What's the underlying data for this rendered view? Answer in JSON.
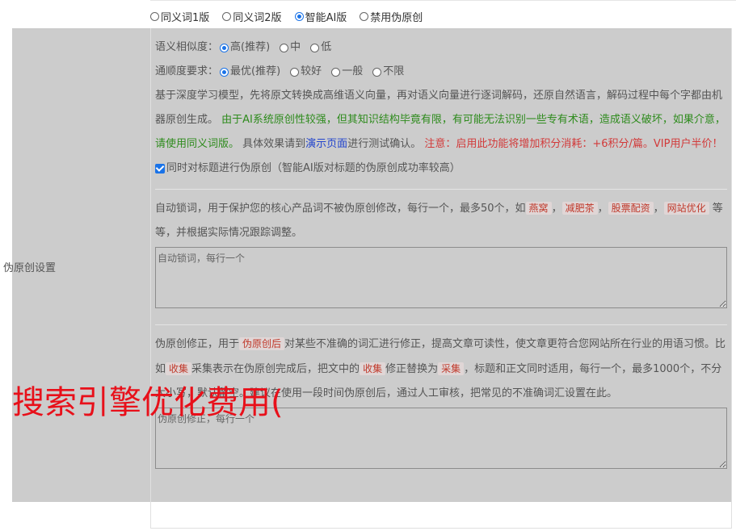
{
  "mode_options": [
    {
      "label": "同义词1版",
      "checked": false
    },
    {
      "label": "同义词2版",
      "checked": false
    },
    {
      "label": "智能AI版",
      "checked": true
    },
    {
      "label": "禁用伪原创",
      "checked": false
    }
  ],
  "side_label": "伪原创设置",
  "similarity": {
    "label": "语义相似度：",
    "options": [
      {
        "label": "高(推荐)",
        "checked": true
      },
      {
        "label": "中",
        "checked": false
      },
      {
        "label": "低",
        "checked": false
      }
    ]
  },
  "fluency": {
    "label": "通顺度要求：",
    "options": [
      {
        "label": "最优(推荐)",
        "checked": true
      },
      {
        "label": "较好",
        "checked": false
      },
      {
        "label": "一般",
        "checked": false
      },
      {
        "label": "不限",
        "checked": false
      }
    ]
  },
  "description": {
    "part1": "基于深度学习模型，先将原文转换成高维语义向量，再对语义向量进行逐词解码，还原自然语言，解码过程中每个字都由机器原创生成。",
    "part2_green": "由于AI系统原创性较强，但其知识结构毕竟有限，有可能无法识别一些专有术语，造成语义破坏，如果介意，请使用同义词版。",
    "part3": "具体效果请到",
    "demo_link": "演示页面",
    "part4": "进行测试确认。",
    "part5_red": "注意：启用此功能将增加积分消耗：+6积分/篇。VIP用户半价！"
  },
  "title_checkbox": {
    "label": "同时对标题进行伪原创（智能AI版对标题的伪原创成功率较高）",
    "checked": true
  },
  "lock_words": {
    "intro": "自动锁词，用于保护您的核心产品词不被伪原创修改，每行一个，最多50个，如",
    "examples": [
      "燕窝",
      "减肥茶",
      "股票配资",
      "网站优化"
    ],
    "sep": "，",
    "outro": "等等，并根据实际情况跟踪调整。",
    "placeholder": "自动锁词，每行一个"
  },
  "correction": {
    "intro": "伪原创修正，用于",
    "tag1": "伪原创后",
    "text2": "对某些不准确的词汇进行修正，提高文章可读性，使文章更符合您网站所在行业的用语习惯。比如",
    "tag2": "收集",
    "text3": "采集",
    "text3b": "表示在伪原创完成后，把文中的",
    "tag3": "收集",
    "text4": "修正替换为",
    "tag4": "采集",
    "text5": "，标题和正文同时适用，每行一个，最多1000个，不分大小写，默认留空。建议在使用一段时间伪原创后，通过人工审核，把常见的不准确词汇设置在此。",
    "placeholder": "伪原创修正，每行一个"
  },
  "overlay_text": "搜索引擎优化费用("
}
